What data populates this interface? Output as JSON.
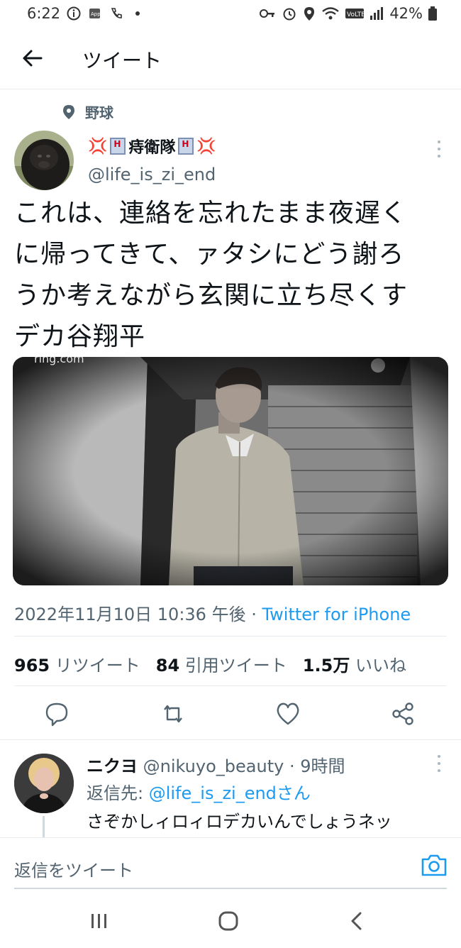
{
  "status_bar": {
    "time": "6:22",
    "battery": "42%"
  },
  "header": {
    "title": "ツイート"
  },
  "tweet": {
    "topic": "野球",
    "display_name": "痔衛隊",
    "handle": "@life_is_zi_end",
    "text_lines": [
      "これは、連絡を忘れたまま夜遅く",
      "に帰ってきて、ァタシにどう謝ろ",
      "うか考えながら玄関に立ち尽くす",
      "デカ谷翔平"
    ],
    "media_watermark": "ring.com",
    "timestamp": "2022年11月10日 10:36 午後 · ",
    "source": "Twitter for iPhone",
    "stats": {
      "retweets_count": "965",
      "retweets_label": "リツイート",
      "quotes_count": "84",
      "quotes_label": "引用ツイート",
      "likes_count": "1.5万",
      "likes_label": "いいね"
    }
  },
  "reply": {
    "display_name": "ニクヨ",
    "handle_time": "@nikuyo_beauty · 9時間",
    "reply_to_label": "返信先: ",
    "reply_to_link": "@life_is_zi_endさん",
    "text": "さぞかしィロィロデカいんでしょうネッ"
  },
  "composer": {
    "placeholder": "返信をツイート"
  },
  "colors": {
    "link": "#1d9bf0",
    "secondary_text": "#536471",
    "primary_text": "#0f1419"
  }
}
